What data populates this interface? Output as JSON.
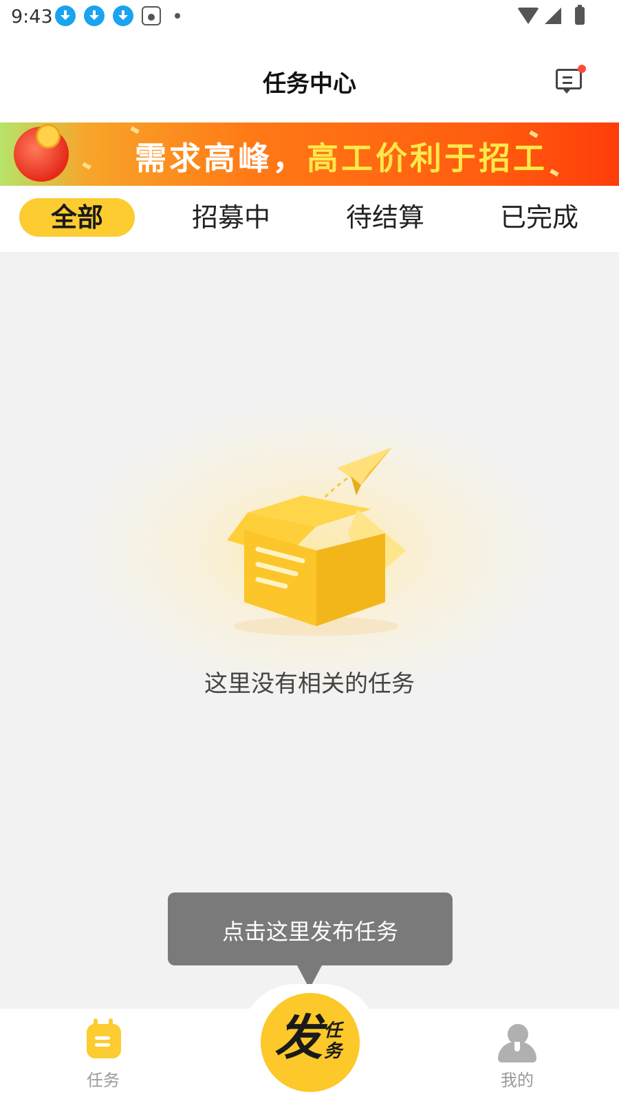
{
  "status_bar": {
    "time": "9:43",
    "left_icons": [
      "download-icon",
      "download-icon",
      "download-icon",
      "baidu-paw-icon",
      "dot-icon"
    ],
    "right_icons": [
      "wifi-icon",
      "signal-icon",
      "battery-charging-icon"
    ]
  },
  "header": {
    "title": "任务中心",
    "message_icon": "message-icon",
    "has_notification": true
  },
  "banner": {
    "text_part1": "需求高峰，",
    "text_part2": "高工价利于招工"
  },
  "tabs": [
    {
      "label": "全部",
      "active": true
    },
    {
      "label": "招募中",
      "active": false
    },
    {
      "label": "待结算",
      "active": false
    },
    {
      "label": "已完成",
      "active": false
    }
  ],
  "empty_state": {
    "illustration": "empty-box-paper-plane-icon",
    "message": "这里没有相关的任务"
  },
  "tooltip": {
    "text": "点击这里发布任务"
  },
  "bottom_nav": {
    "items": [
      {
        "label": "任务",
        "icon": "task-icon",
        "active": true
      },
      {
        "label": "我的",
        "icon": "user-icon",
        "active": false
      }
    ],
    "publish": {
      "big": "发",
      "small": "任务"
    }
  },
  "colors": {
    "accent": "#fccc30",
    "banner_start": "#f7a52a",
    "banner_end": "#ff3d0a",
    "notification_dot": "#ff4d3a",
    "tooltip_bg": "#7a7a7a"
  }
}
